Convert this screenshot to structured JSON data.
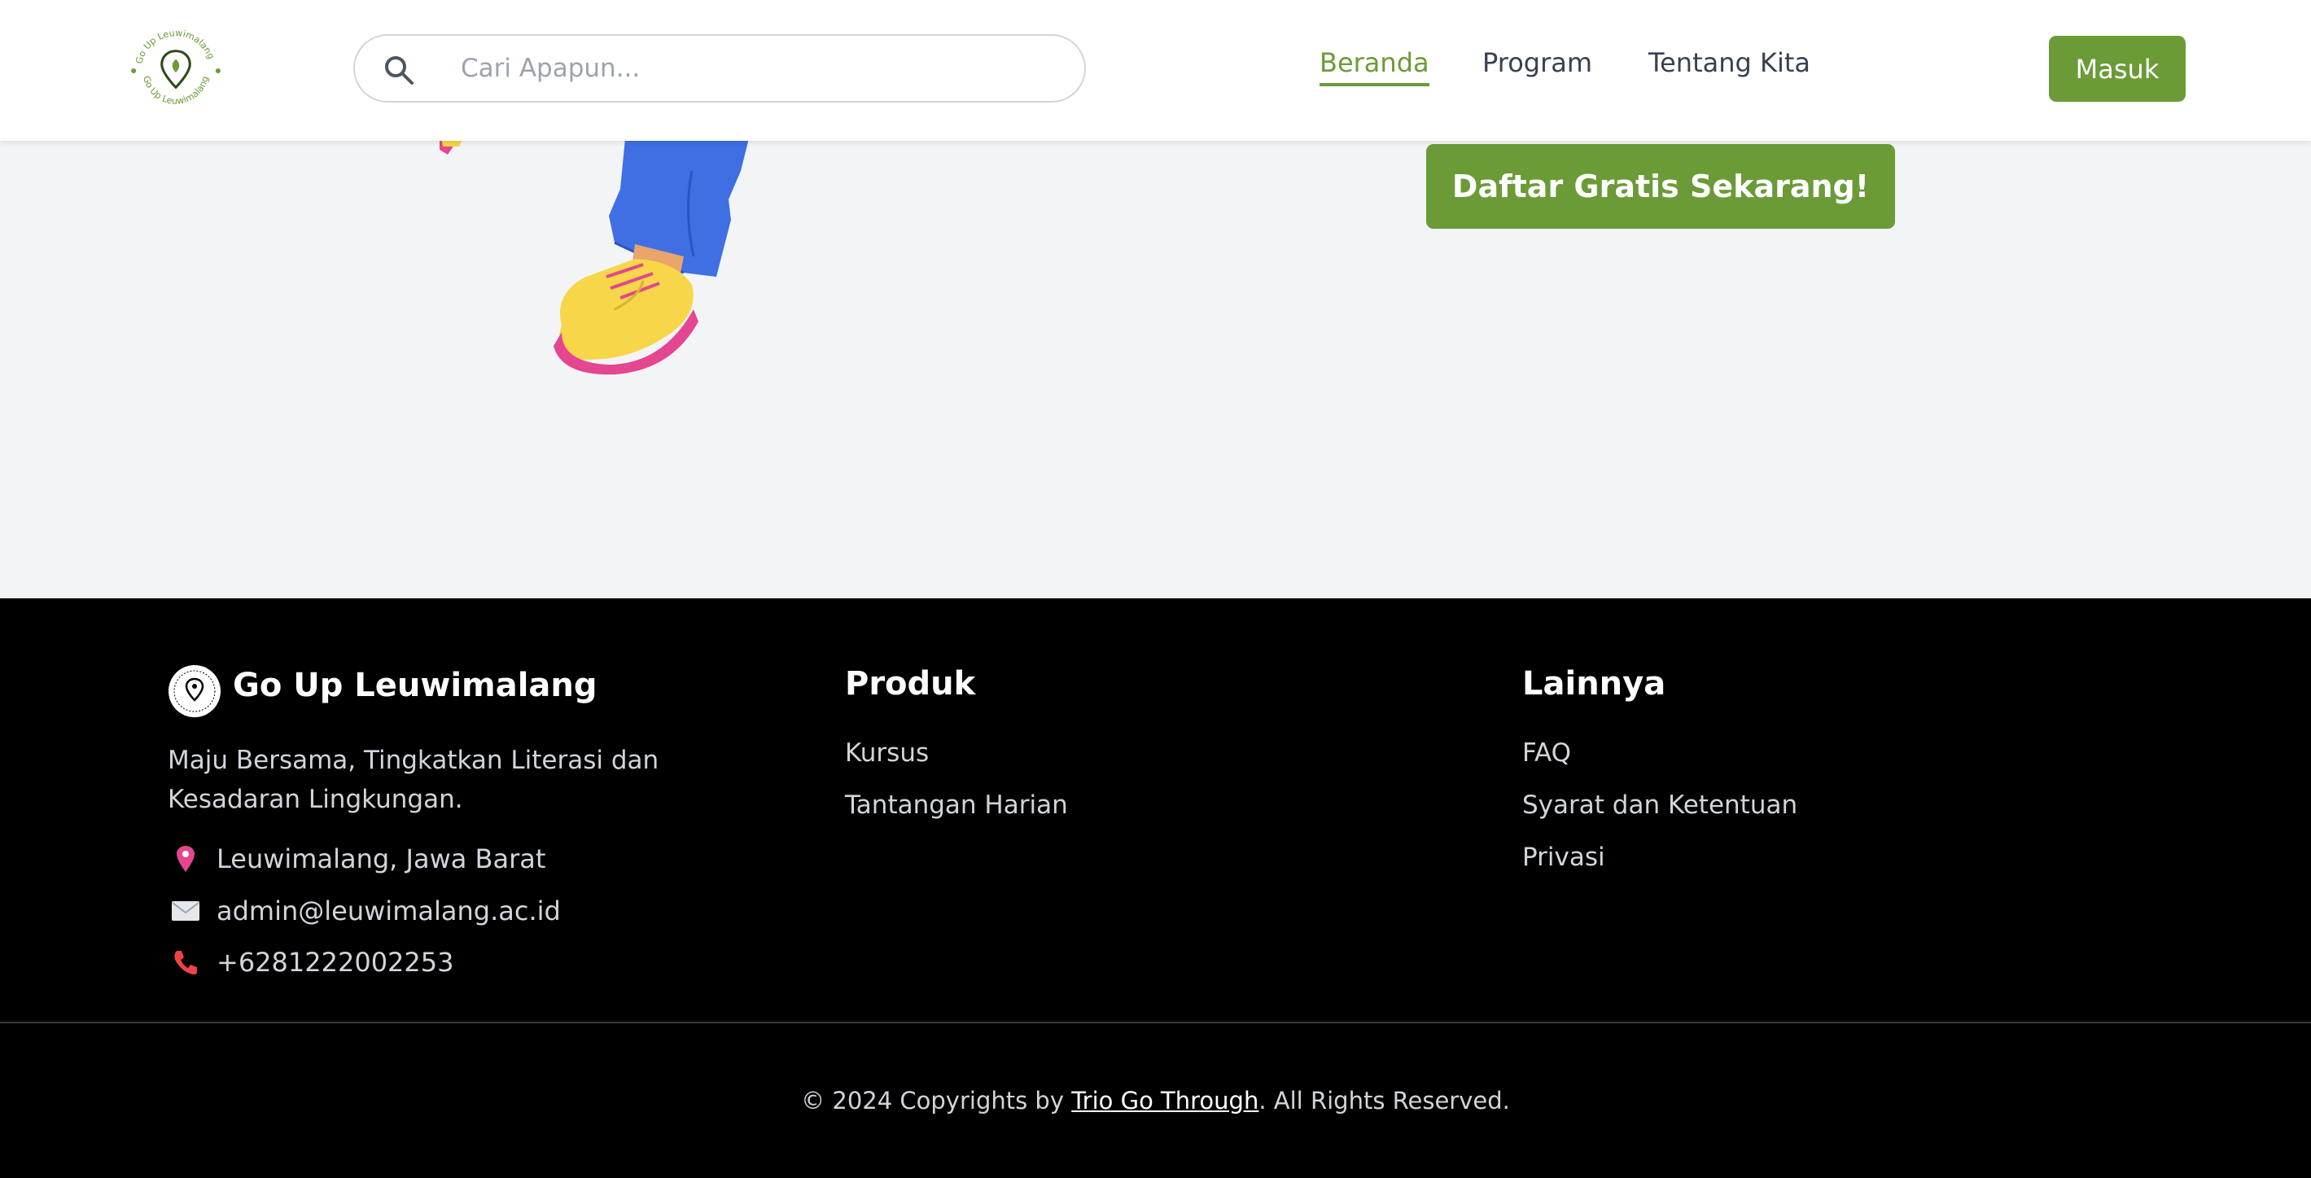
{
  "header": {
    "logo_text": "Go Up Leuwimalang",
    "search_placeholder": "Cari Apapun...",
    "nav": [
      "Beranda",
      "Program",
      "Tentang Kita"
    ],
    "active_nav": "Beranda",
    "login_label": "Masuk"
  },
  "hero": {
    "cta_label": "Daftar Gratis Sekarang!"
  },
  "footer": {
    "brand_name": "Go Up Leuwimalang",
    "tagline": "Maju Bersama, Tingkatkan Literasi dan Kesadaran Lingkungan.",
    "contacts": [
      {
        "icon": "map-pin-icon",
        "text": "Leuwimalang, Jawa Barat"
      },
      {
        "icon": "envelope-icon",
        "text": "admin@leuwimalang.ac.id"
      },
      {
        "icon": "phone-icon",
        "text": "+6281222002253"
      }
    ],
    "produk": {
      "heading": "Produk",
      "links": [
        "Kursus",
        "Tantangan Harian"
      ]
    },
    "lainnya": {
      "heading": "Lainnya",
      "links": [
        "FAQ",
        "Syarat dan Ketentuan",
        "Privasi"
      ]
    },
    "copyright": {
      "prefix": "© 2024 Copyrights by ",
      "link": "Trio Go Through",
      "suffix": ". All Rights Reserved."
    }
  },
  "colors": {
    "brand_green": "#6b9b37",
    "footer_bg": "#000000",
    "page_bg": "#f3f4f6"
  }
}
